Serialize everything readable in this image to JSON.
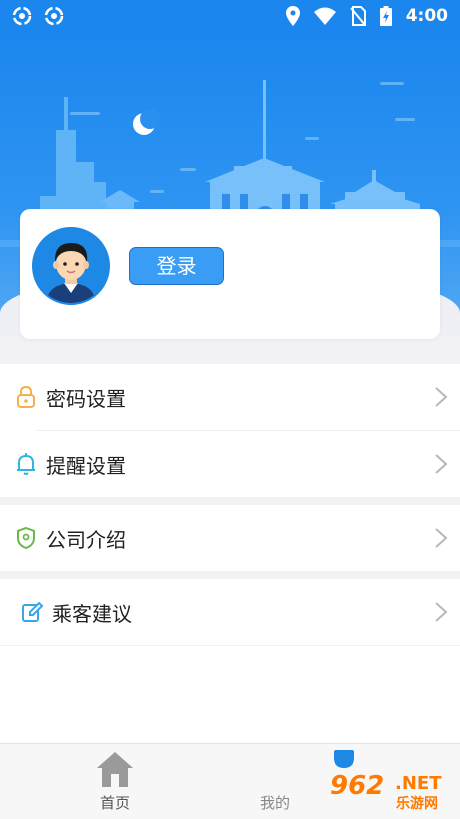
{
  "status_bar": {
    "time": "4:00",
    "icons": [
      "sync-icon",
      "sync-icon",
      "location-icon",
      "wifi-icon",
      "no-sim-icon",
      "battery-charging-icon"
    ]
  },
  "profile": {
    "login_label": "登录",
    "avatar_icon": "user-avatar"
  },
  "menu": {
    "items": [
      {
        "label": "密码设置",
        "icon": "lock-icon",
        "color": "#f0b34a"
      },
      {
        "label": "提醒设置",
        "icon": "bell-icon",
        "color": "#2fb6e0"
      },
      {
        "label": "公司介绍",
        "icon": "shield-icon",
        "color": "#6bb84a"
      },
      {
        "label": "乘客建议",
        "icon": "edit-icon",
        "color": "#3aa6e8"
      }
    ]
  },
  "bottom_nav": {
    "items": [
      {
        "label": "首页",
        "icon": "home-icon"
      },
      {
        "label": "我的",
        "icon": "user-icon"
      }
    ]
  },
  "watermark": {
    "number": "962",
    "suffix": ".NET",
    "text": "乐游网"
  },
  "colors": {
    "primary": "#1b86ee",
    "button": "#3a9df5",
    "background": "#f2f2f5"
  }
}
